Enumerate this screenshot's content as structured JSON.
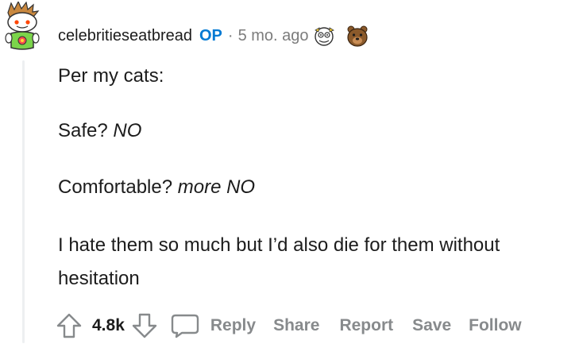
{
  "comment": {
    "author": "celebritieseatbread",
    "op_badge": "OP",
    "separator": "·",
    "time_ago": "5 mo. ago",
    "avatar": "snoo-avatar",
    "awards": [
      "helpful-award-icon",
      "bear-award-icon"
    ],
    "paragraphs": {
      "p1": {
        "text": "Per my cats:"
      },
      "p2": {
        "plain": "Safe? ",
        "italic": "NO"
      },
      "p3": {
        "plain": "Comfortable? ",
        "italic": "more NO"
      },
      "p4": {
        "text": "I hate them so much but I’d also die for them without hesitation"
      }
    }
  },
  "actions": {
    "score": "4.8k",
    "reply": "Reply",
    "share": "Share",
    "report": "Report",
    "save": "Save",
    "follow": "Follow"
  },
  "colors": {
    "op_badge": "#0079d3",
    "meta_gray": "#7c7c7c",
    "action_gray": "#878a8c",
    "text": "#1c1c1c",
    "thread_line": "#edeff1"
  }
}
